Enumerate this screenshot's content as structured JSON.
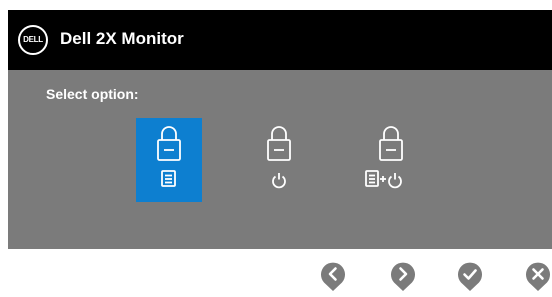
{
  "header": {
    "logo_text": "DELL",
    "title": "Dell 2X Monitor"
  },
  "prompt": "Select option:",
  "options": [
    {
      "id": "lock-menu",
      "icon": "lock-menu-icon",
      "selected": true
    },
    {
      "id": "lock-power",
      "icon": "lock-power-icon",
      "selected": false
    },
    {
      "id": "lock-menu-power",
      "icon": "lock-menu-power-icon",
      "selected": false
    }
  ],
  "nav": [
    "previous",
    "next",
    "confirm",
    "exit"
  ],
  "colors": {
    "header_bg": "#000000",
    "panel_bg": "#7b7b7b",
    "selected_bg": "#0d7fd0",
    "nav_button": "#7b7b7b",
    "text": "#ffffff"
  }
}
